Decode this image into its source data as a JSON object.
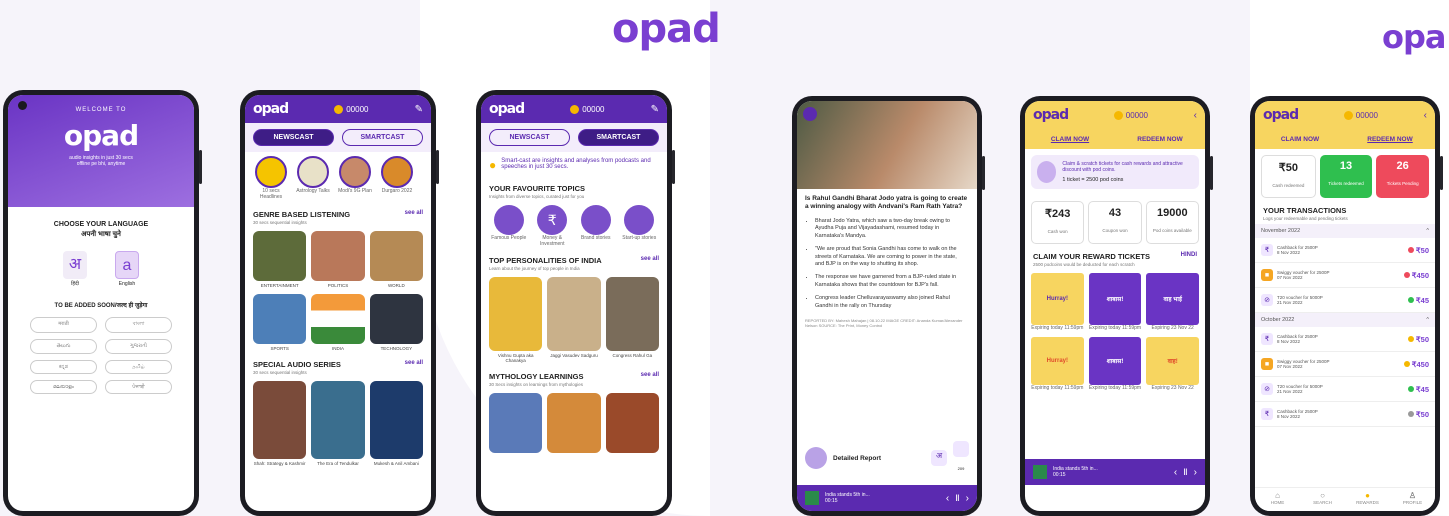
{
  "brand": {
    "logo": "opad",
    "logo_right": "opa"
  },
  "screen1": {
    "welcome": "WELCOME TO",
    "logo": "opad",
    "tag1": "audio insights in just 30 secs",
    "tag2": "offline pe bhi, anytime",
    "choose_title": "CHOOSE YOUR LANGUAGE",
    "choose_hindi": "अपनी भाषा चुने",
    "lang1_glyph": "अ",
    "lang1_label": "हिंदी",
    "lang2_glyph": "a",
    "lang2_label": "English",
    "soon_title": "TO BE ADDED SOON/जल्द ही जुड़ेगा",
    "soon_langs": [
      "मराठी",
      "বাংলা",
      "తెలుగు",
      "ગુજરાતી",
      "ಕನ್ನಡ",
      "தமிழ்",
      "മലയാളം",
      "ਪੰਜਾਬੀ"
    ]
  },
  "screen2": {
    "coins": "00000",
    "tab_newscast": "NEWSCAST",
    "tab_smartcast": "SMARTCAST",
    "stories": [
      "10 secs Headlines",
      "Astrology Talks",
      "Modi's 9G Plan",
      "Durgaro 2022"
    ],
    "genre_title": "GENRE BASED LISTENING",
    "genre_sub": "30 secs sequential insights",
    "see_all": "see all",
    "genres": [
      "ENTERTAINMENT",
      "POLITICS",
      "WORLD",
      "SPORTS",
      "INDIA",
      "TECHNOLOGY"
    ],
    "special_title": "SPECIAL AUDIO SERIES",
    "special_sub": "30 secs sequential insights",
    "series": [
      "Shah: Strategy & Kashmir",
      "The Era of Tendulkar",
      "Mukesh & Anil Ambani"
    ]
  },
  "screen3": {
    "coins": "00000",
    "tab_newscast": "NEWSCAST",
    "tab_smartcast": "SMARTCAST",
    "intro": "Smart-cast are insights and analyses from podcasts and speeches in just 30 secs.",
    "fav_title": "YOUR FAVOURITE TOPICS",
    "fav_sub": "Insights from diverse topics, curated just for you",
    "topics": [
      "Famous People",
      "Money & Investment",
      "Brand stories",
      "Start-up stories"
    ],
    "top_title": "TOP PERSONALITIES OF INDIA",
    "top_sub": "Learn about the journey of top people in India",
    "see_all": "see all",
    "people": [
      "Vishnu Gupta aka Chanakya",
      "Jaggi Vasudev Sadguru",
      "Congress Rahul Ga"
    ],
    "myth_title": "MYTHOLOGY LEARNINGS",
    "myth_sub": "30 Secs insights on learnings from mythologies"
  },
  "screen4": {
    "headline": "Is Rahul Gandhi Bharat Jodo yatra is going to create a winning analogy with Andvani's Ram Rath Yatra?",
    "bullets": [
      "Bharat Jodo Yatra, which saw a two-day break owing to Ayudha Puja and Vijayadashami, resumed today in Karnataka's Mandya.",
      "\"We are proud that Sonia Gandhi has come to walk on the streets of Karnataka. We are coming to power in the state, and BJP is on the way to shutting its shop.",
      "The response we have garnered from a BJP-ruled state in Karnataka shows that the countdown for BJP's fall.",
      "Congress leader Chelluvarayaswamy also joined Rahul Gandhi in the rally on Thursday"
    ],
    "credits": "REPORTED BY: Mahesh Mahajan | 08.10.22  IMAGE CREDIT: Ananda Kumar/Alexander Nelson  SOURCE: The Print, Money Control",
    "report_label": "Detailed Report",
    "share_count": "209",
    "player_title": "India stands 5th in...",
    "player_time": "00:15"
  },
  "screen5": {
    "coins": "00000",
    "tab_claim": "CLAIM NOW",
    "tab_redeem": "REDEEM NOW",
    "promo": "Claim & scratch tickets for cash rewards and attractive discount with pod coins.",
    "ticket_rate": "1 ticket = 2500 pod coins",
    "stats": [
      {
        "value": "₹243",
        "label": "Cash won"
      },
      {
        "value": "43",
        "label": "Coupon won"
      },
      {
        "value": "19000",
        "label": "Pod coins available"
      }
    ],
    "claim_title": "CLAIM YOUR REWARD TICKETS",
    "claim_link": "HINDI",
    "claim_sub": "2500 podcoins would be deducted for each scratch",
    "tickets": [
      {
        "label": "Hurray!",
        "expiry": "Expiring today 11:59pm"
      },
      {
        "label": "शाबास!",
        "expiry": "Expiring today 11:59pm"
      },
      {
        "label": "वाह भाई",
        "expiry": "Expiring 23 Nov 22"
      }
    ],
    "row2": [
      {
        "label": "Hurray!",
        "expiry": "Expiring today 11:59pm"
      },
      {
        "label": "शाबास!",
        "expiry": "Expiring today 11:59pm"
      },
      {
        "label": "वाह!",
        "expiry": "Expiring 23 Nov 22"
      }
    ],
    "player_title": "India stands 5th in...",
    "player_time": "00:15"
  },
  "screen6": {
    "coins": "00000",
    "tab_claim": "CLAIM NOW",
    "tab_redeem": "REDEEM NOW",
    "cards": [
      {
        "value": "₹50",
        "label": "Cash redeemed",
        "color": "#ffffff"
      },
      {
        "value": "13",
        "label": "Tickets redeemed",
        "color": "#2fbf4f"
      },
      {
        "value": "26",
        "label": "Tickets Pending",
        "color": "#ee4a5c"
      }
    ],
    "tx_title": "YOUR TRANSACTIONS",
    "tx_sub": "Logs your redeemable and pending tickets",
    "months": [
      {
        "name": "November 2022",
        "items": [
          {
            "desc": "Cashback for 2500P",
            "date": "8 Nov 2022",
            "amt": "₹50",
            "status": "#ee4a5c"
          },
          {
            "desc": "Swiggy voucher for 2500P",
            "date": "07 Nov 2022",
            "amt": "₹450",
            "status": "#ee4a5c"
          },
          {
            "desc": "T20 voucher for 5000P",
            "date": "21 Nov 2022",
            "amt": "₹45",
            "status": "#2fbf4f"
          }
        ]
      },
      {
        "name": "October 2022",
        "items": [
          {
            "desc": "Cashback for 2500P",
            "date": "8 Nov 2022",
            "amt": "₹50",
            "status": "#f5b800"
          },
          {
            "desc": "Swiggy voucher for 2500P",
            "date": "07 Nov 2022",
            "amt": "₹450",
            "status": "#f5b800"
          },
          {
            "desc": "T20 voucher for 5000P",
            "date": "21 Nov 2022",
            "amt": "₹45",
            "status": "#2fbf4f"
          },
          {
            "desc": "Cashback for 2500P",
            "date": "8 Nov 2022",
            "amt": "₹50",
            "status": "#999999"
          }
        ]
      }
    ],
    "nav": [
      "HOME",
      "SEARCH",
      "REWARDS",
      "PROFILE"
    ]
  }
}
